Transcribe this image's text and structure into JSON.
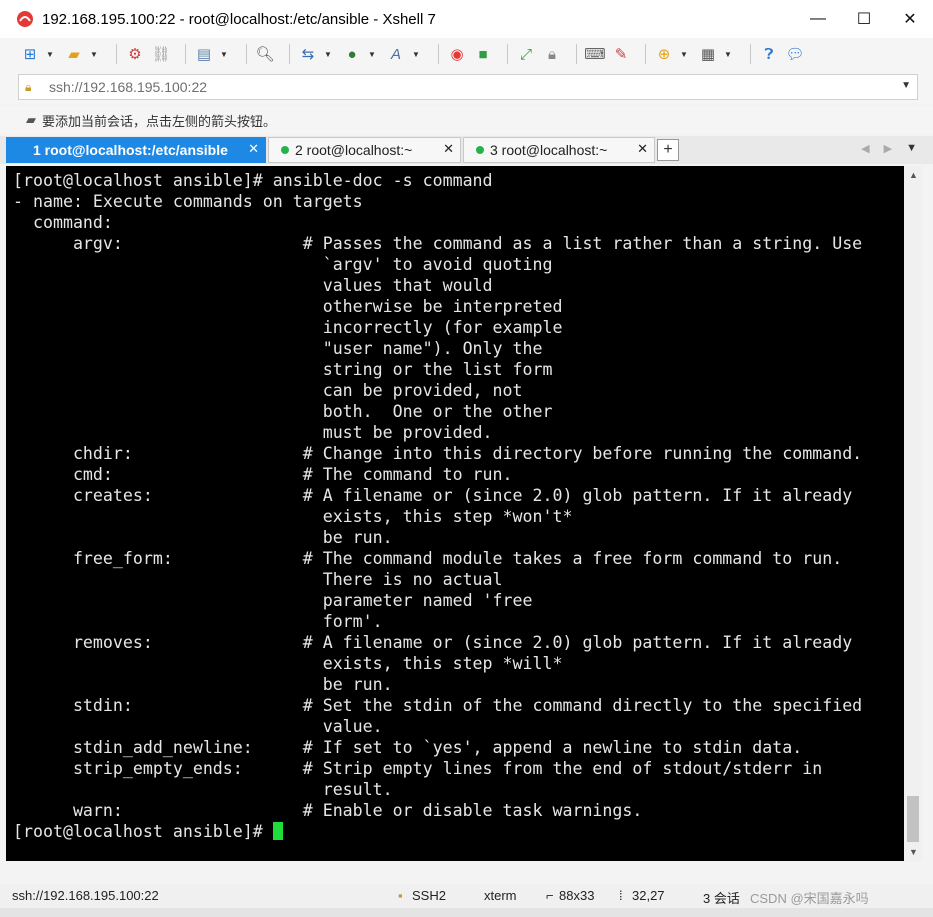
{
  "window": {
    "title": "192.168.195.100:22 - root@localhost:/etc/ansible - Xshell 7",
    "controls": {
      "minimize": "—",
      "maximize": "☐",
      "close": "✕"
    }
  },
  "address_bar": {
    "value": "ssh://192.168.195.100:22"
  },
  "hint": {
    "text": "要添加当前会话，点击左侧的箭头按钮。"
  },
  "tabs": [
    {
      "label": "1 root@localhost:/etc/ansible",
      "active": true
    },
    {
      "label": "2 root@localhost:~",
      "active": false
    },
    {
      "label": "3 root@localhost:~",
      "active": false
    }
  ],
  "tab_add": "+",
  "terminal": {
    "lines": [
      "[root@localhost ansible]# ansible-doc -s command",
      "- name: Execute commands on targets",
      "  command:",
      "      argv:                  # Passes the command as a list rather than a string. Use",
      "                               `argv' to avoid quoting",
      "                               values that would",
      "                               otherwise be interpreted",
      "                               incorrectly (for example",
      "                               \"user name\"). Only the",
      "                               string or the list form",
      "                               can be provided, not",
      "                               both.  One or the other",
      "                               must be provided.",
      "      chdir:                 # Change into this directory before running the command.",
      "      cmd:                   # The command to run.",
      "      creates:               # A filename or (since 2.0) glob pattern. If it already",
      "                               exists, this step *won't*",
      "                               be run.",
      "      free_form:             # The command module takes a free form command to run.",
      "                               There is no actual",
      "                               parameter named 'free",
      "                               form'.",
      "      removes:               # A filename or (since 2.0) glob pattern. If it already",
      "                               exists, this step *will*",
      "                               be run.",
      "      stdin:                 # Set the stdin of the command directly to the specified",
      "                               value.",
      "      stdin_add_newline:     # If set to `yes', append a newline to stdin data.",
      "      strip_empty_ends:      # Strip empty lines from the end of stdout/stderr in",
      "                               result.",
      "      warn:                  # Enable or disable task warnings."
    ],
    "prompt": "[root@localhost ansible]# "
  },
  "status_bar": {
    "connection": "ssh://192.168.195.100:22",
    "protocol": "SSH2",
    "terminal_type": "xterm",
    "size": "88x33",
    "position": "32,27",
    "sessions": "3 会话",
    "watermark": "CSDN @宋国嘉永吗"
  },
  "colors": {
    "active_tab": "#1e88e5",
    "terminal_bg": "#000000",
    "cursor": "#1fdc3b",
    "session_dot": "#26b24a"
  }
}
